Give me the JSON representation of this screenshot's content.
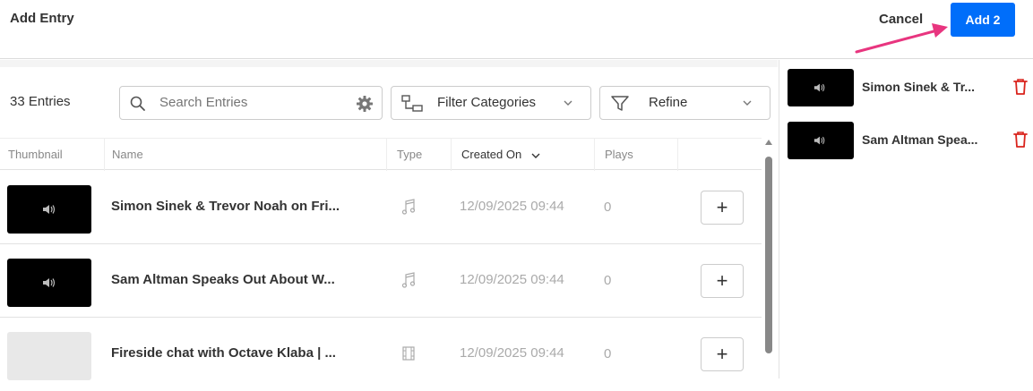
{
  "header": {
    "title": "Add Entry",
    "cancel_label": "Cancel",
    "add_label": "Add 2",
    "accent_color": "#006efa",
    "arrow_color": "#e8357f"
  },
  "toolbar": {
    "entries_count": "33 Entries",
    "search_placeholder": "Search Entries",
    "filter_label": "Filter Categories",
    "refine_label": "Refine"
  },
  "table": {
    "columns": [
      "Thumbnail",
      "Name",
      "Type",
      "Created On",
      "Plays"
    ],
    "sort_column": "Created On",
    "rows": [
      {
        "name": "Simon Sinek & Trevor Noah on Fri...",
        "type": "audio",
        "created": "12/09/2025 09:44",
        "plays": "0",
        "thumb": "audio"
      },
      {
        "name": "Sam Altman Speaks Out About W...",
        "type": "audio",
        "created": "12/09/2025 09:44",
        "plays": "0",
        "thumb": "audio"
      },
      {
        "name": "Fireside chat with Octave Klaba | ...",
        "type": "video",
        "created": "12/09/2025 09:44",
        "plays": "0",
        "thumb": "blank"
      }
    ]
  },
  "selected": {
    "items": [
      {
        "name": "Simon Sinek & Tr..."
      },
      {
        "name": "Sam Altman Spea..."
      }
    ]
  }
}
